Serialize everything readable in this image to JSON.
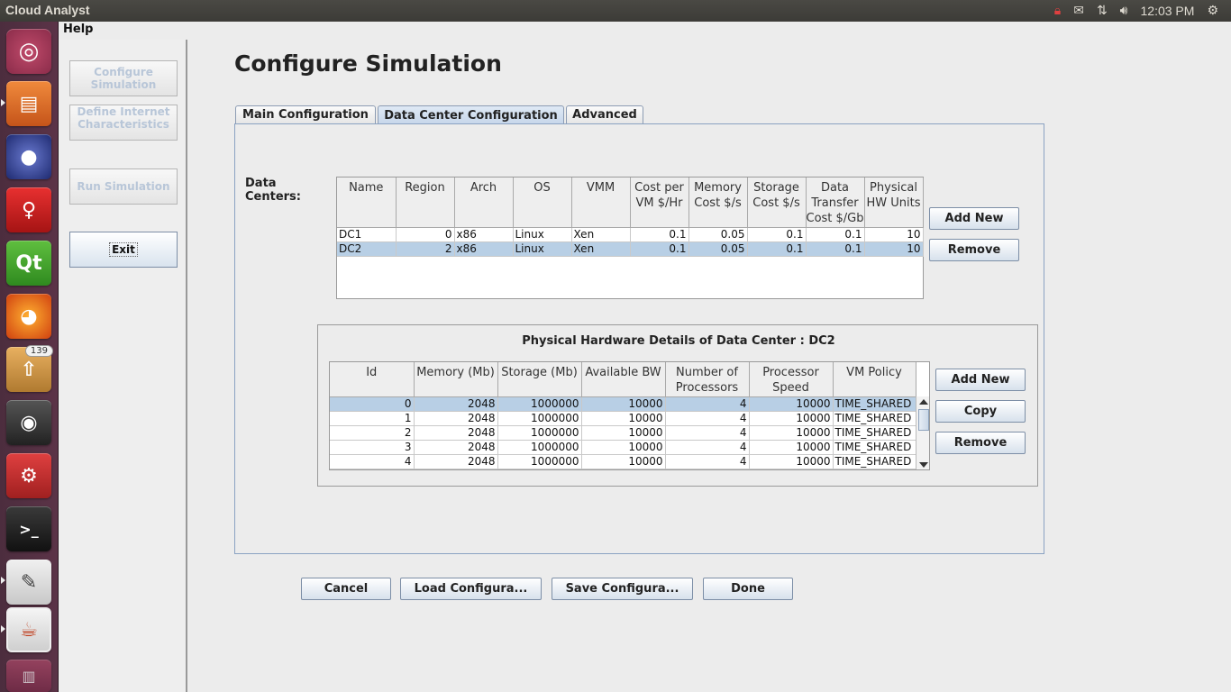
{
  "window": {
    "title": "Cloud Analyst"
  },
  "tray": {
    "clock": "12:03 PM"
  },
  "launcher": {
    "badge_count": "139"
  },
  "menu": {
    "help": "Help"
  },
  "nav": {
    "configure": "Configure Simulation",
    "define": "Define Internet Characteristics",
    "run": "Run Simulation",
    "exit": "Exit"
  },
  "page": {
    "title": "Configure Simulation"
  },
  "tabs": [
    "Main Configuration",
    "Data Center Configuration",
    "Advanced"
  ],
  "datacenters": {
    "label": "Data Centers:",
    "headers": [
      "Name",
      "Region",
      "Arch",
      "OS",
      "VMM",
      "Cost per VM $/Hr",
      "Memory Cost $/s",
      "Storage Cost $/s",
      "Data Transfer Cost $/Gb",
      "Physical HW Units"
    ],
    "rows": [
      [
        "DC1",
        "0",
        "x86",
        "Linux",
        "Xen",
        "0.1",
        "0.05",
        "0.1",
        "0.1",
        "10"
      ],
      [
        "DC2",
        "2",
        "x86",
        "Linux",
        "Xen",
        "0.1",
        "0.05",
        "0.1",
        "0.1",
        "10"
      ]
    ],
    "selected_row": 1,
    "add_new": "Add New",
    "remove": "Remove"
  },
  "hardware": {
    "title": "Physical Hardware Details of Data Center : DC2",
    "headers": [
      "Id",
      "Memory (Mb)",
      "Storage (Mb)",
      "Available BW",
      "Number of Processors",
      "Processor Speed",
      "VM Policy"
    ],
    "rows": [
      [
        "0",
        "2048",
        "1000000",
        "10000",
        "4",
        "10000",
        "TIME_SHARED"
      ],
      [
        "1",
        "2048",
        "1000000",
        "10000",
        "4",
        "10000",
        "TIME_SHARED"
      ],
      [
        "2",
        "2048",
        "1000000",
        "10000",
        "4",
        "10000",
        "TIME_SHARED"
      ],
      [
        "3",
        "2048",
        "1000000",
        "10000",
        "4",
        "10000",
        "TIME_SHARED"
      ],
      [
        "4",
        "2048",
        "1000000",
        "10000",
        "4",
        "10000",
        "TIME_SHARED"
      ]
    ],
    "selected_row": 0,
    "add_new": "Add New",
    "copy": "Copy",
    "remove": "Remove"
  },
  "footer": {
    "cancel": "Cancel",
    "load": "Load Configura...",
    "save": "Save Configura...",
    "done": "Done"
  }
}
